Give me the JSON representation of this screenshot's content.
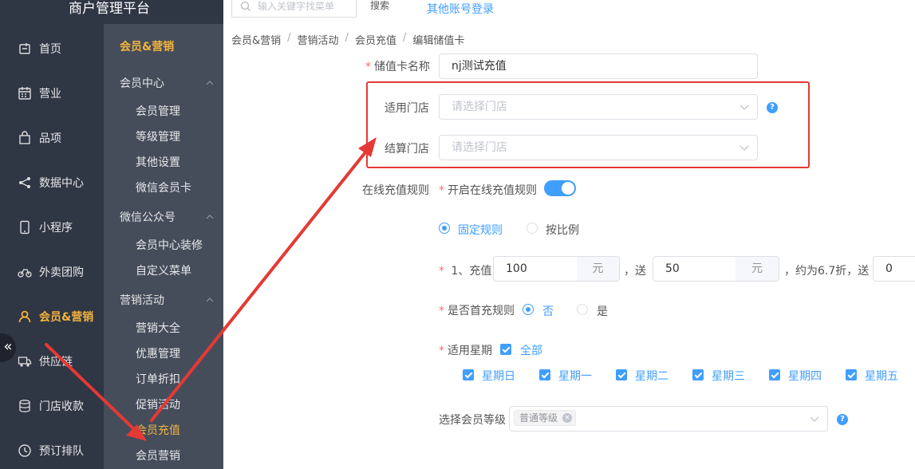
{
  "app": {
    "title": "商户管理平台"
  },
  "rail": {
    "items": [
      {
        "label": "首页",
        "icon": "home-icon"
      },
      {
        "label": "营业",
        "icon": "calendar-icon"
      },
      {
        "label": "品项",
        "icon": "bag-icon"
      },
      {
        "label": "数据中心",
        "icon": "share-icon"
      },
      {
        "label": "小程序",
        "icon": "mobile-icon"
      },
      {
        "label": "外卖团购",
        "icon": "bike-icon"
      },
      {
        "label": "会员&营销",
        "icon": "user-icon",
        "active": true
      },
      {
        "label": "供应链",
        "icon": "truck-icon"
      },
      {
        "label": "门店收款",
        "icon": "database-icon"
      },
      {
        "label": "预订排队",
        "icon": "clock-icon"
      }
    ],
    "collapse_glyph": "«"
  },
  "subnav": {
    "title": "会员&营销",
    "groups": [
      {
        "label": "会员中心",
        "items": [
          "会员管理",
          "等级管理",
          "其他设置",
          "微信会员卡"
        ]
      },
      {
        "label": "微信公众号",
        "items": [
          "会员中心装修",
          "自定义菜单"
        ]
      },
      {
        "label": "营销活动",
        "items": [
          "营销大全",
          "优惠管理",
          "订单折扣",
          "促销活动",
          "会员充值",
          "会员营销"
        ]
      }
    ],
    "active_item": "会员充值"
  },
  "topbar": {
    "search_placeholder": "输入关键字找菜单",
    "search_button": "搜索",
    "other_login": "其他账号登录"
  },
  "breadcrumb": [
    "会员&营销",
    "营销活动",
    "会员充值",
    "编辑储值卡"
  ],
  "form": {
    "card_name_label": "储值卡名称",
    "card_name_value": "nj测试充值",
    "store_label": "适用门店",
    "store_placeholder": "请选择门店",
    "settle_store_label": "结算门店",
    "settle_store_placeholder": "请选择门店",
    "online_rule_label": "在线充值规则",
    "enable_online_label": "开启在线充值规则",
    "enable_online_on": true,
    "rule_fixed_label": "固定规则",
    "rule_ratio_label": "按比例",
    "rule_selected": "固定规则",
    "rule1_prefix": "1、充值",
    "rule1_amount": "100",
    "unit_yuan": "元",
    "rule1_gift_prefix": "，送",
    "rule1_gift": "50",
    "rule1_discount_text": "，约为6.7折，送",
    "rule1_extra": "0",
    "first_charge_label": "是否首充规则",
    "first_no": "否",
    "first_yes": "是",
    "first_selected": "否",
    "weekday_label": "适用星期",
    "weekday_all": "全部",
    "weekdays": [
      "星期日",
      "星期一",
      "星期二",
      "星期三",
      "星期四",
      "星期五"
    ],
    "member_level_label": "选择会员等级",
    "member_level_tag": "普通等级",
    "help_glyph": "?"
  },
  "colors": {
    "accent": "#409eff",
    "highlight": "#f3b33d",
    "annotation": "#e53935",
    "rail_bg": "#2f3644",
    "subnav_bg": "#454d5b"
  }
}
